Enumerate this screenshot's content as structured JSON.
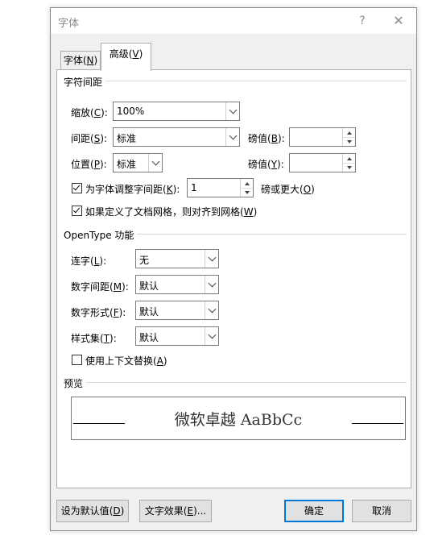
{
  "title": "字体",
  "titlebar": {
    "help": "?",
    "close": "✕"
  },
  "tabs": [
    {
      "label": "字体",
      "key": "N"
    },
    {
      "label": "高级",
      "key": "V"
    }
  ],
  "char_spacing": {
    "group_label": "字符间距",
    "scale": {
      "label": "缩放",
      "key": "C",
      "value": "100%"
    },
    "spacing": {
      "label": "间距",
      "key": "S",
      "value": "标准",
      "by_label": "磅值",
      "by_key": "B",
      "by_value": ""
    },
    "position": {
      "label": "位置",
      "key": "P",
      "value": "标准",
      "by_label": "磅值",
      "by_key": "Y",
      "by_value": ""
    },
    "kerning": {
      "label": "为字体调整字间距",
      "key": "K",
      "checked": true,
      "value": "1",
      "suffix": "磅或更大",
      "suffix_key": "O"
    },
    "snap_grid": {
      "label": "如果定义了文档网格，则对齐到网格",
      "key": "W",
      "checked": true
    }
  },
  "opentype": {
    "group_label": "OpenType 功能",
    "ligatures": {
      "label": "连字",
      "key": "L",
      "value": "无"
    },
    "number_spacing": {
      "label": "数字间距",
      "key": "M",
      "value": "默认"
    },
    "number_forms": {
      "label": "数字形式",
      "key": "F",
      "value": "默认"
    },
    "stylistic_sets": {
      "label": "样式集",
      "key": "T",
      "value": "默认"
    },
    "contextual": {
      "label": "使用上下文替换",
      "key": "A",
      "checked": false
    }
  },
  "preview": {
    "group_label": "预览",
    "text": "微软卓越  AaBbCc"
  },
  "buttons": {
    "set_default": {
      "label": "设为默认值",
      "key": "D"
    },
    "text_effects": {
      "label": "文字效果",
      "key": "E",
      "suffix": "..."
    },
    "ok": "确定",
    "cancel": "取消"
  },
  "colors": {
    "accent": "#0078d7",
    "dialog_bg": "#f0f0f0",
    "panel_bg": "#ffffff"
  }
}
